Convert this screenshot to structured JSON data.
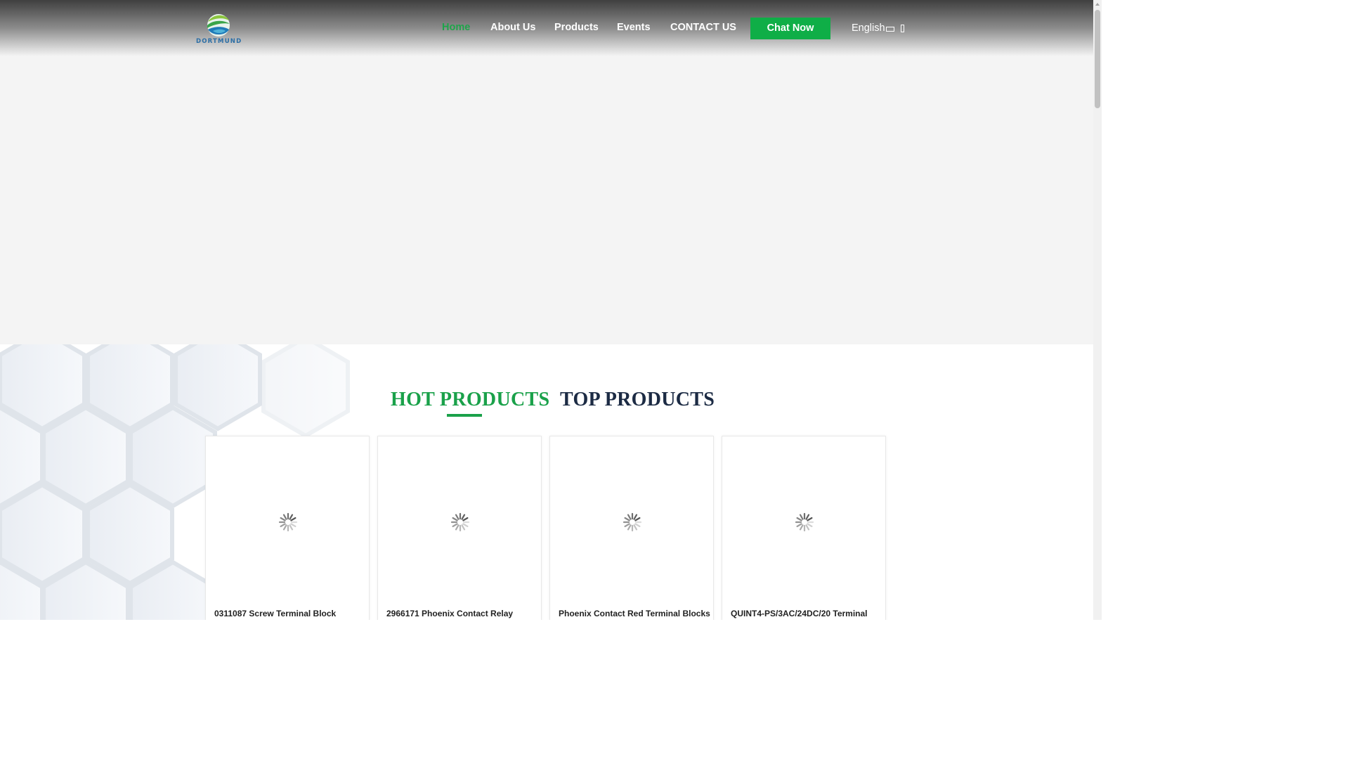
{
  "header": {
    "logo_text": "DORTMUND",
    "nav": {
      "home": "Home",
      "about": "About Us",
      "products": "Products",
      "events": "Events",
      "contact": "CONTACT US"
    },
    "chat_button": "Chat Now",
    "language": "English"
  },
  "products": {
    "tabs": {
      "hot": "HOT PRODUCTS",
      "top": "TOP PRODUCTS"
    },
    "active_tab": "hot",
    "items": [
      {
        "title": "0311087 Screw Terminal Block"
      },
      {
        "title": "2966171 Phoenix Contact Relay"
      },
      {
        "title": "Phoenix Contact Red Terminal Blocks"
      },
      {
        "title": "QUINT4-PS/3AC/24DC/20 Terminal"
      }
    ]
  },
  "colors": {
    "accent_green": "#0fae47",
    "heading_navy": "#1c2b44",
    "logo_blue": "#2b6ea6"
  }
}
